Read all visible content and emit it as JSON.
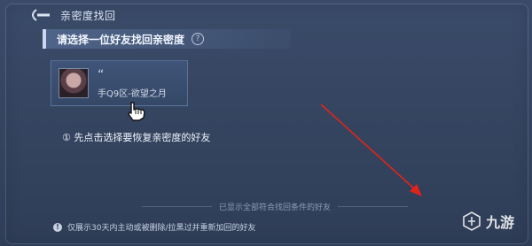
{
  "header": {
    "title": "亲密度找回"
  },
  "section": {
    "title": "请选择一位好友找回亲密度",
    "help_glyph": "?"
  },
  "friend": {
    "quote": "“",
    "server": "手Q9区-欲望之月"
  },
  "hint": {
    "text": "① 先点击选择要恢复亲密度的好友"
  },
  "list_footer": {
    "text": "已显示全部符合找回条件的好友"
  },
  "footnote": {
    "icon": "!",
    "text": "仅展示30天内主动或被删除/拉黑过并重新加回的好友"
  },
  "watermark": {
    "text": "九游"
  },
  "colors": {
    "annotation_arrow": "#e2231a"
  }
}
